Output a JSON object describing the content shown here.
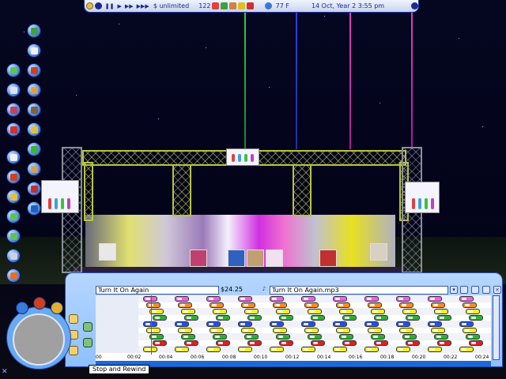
{
  "status_bar": {
    "money": "$ unlimited",
    "speed_value": "122",
    "temperature": "77 F",
    "date_time": "14 Oct, Year 2  3:55 pm",
    "playback_controls": [
      "pause",
      "play",
      "fast",
      "fastest"
    ]
  },
  "panel": {
    "show_name": "Turn It On Again",
    "price": "$24.25",
    "music_track": "Turn It On Again.mp3",
    "timeline_labels": [
      "00",
      "00:02",
      "00:04",
      "00:06",
      "00:08",
      "00:10",
      "00:12",
      "00:14",
      "00:16",
      "00:18",
      "00:20",
      "00:22",
      "00:24"
    ],
    "track_colors": [
      "#f060e0",
      "#ff8a20",
      "#f0f020",
      "#30b030",
      "#2050f0",
      "#f0f020",
      "#30b030",
      "#e02020",
      "#f0f020"
    ],
    "tooltip": "Stop and Rewind"
  },
  "colors": {
    "panel": "#a8ccff",
    "accent": "#1e3aa8"
  },
  "icons": {
    "left_toolbar": [
      "terrain-icon",
      "scenery-icon",
      "paths-icon",
      "rides-icon",
      "guests-icon",
      "shops-icon",
      "staff-icon",
      "finance-icon",
      "stats-icon",
      "research-icon",
      "award-icon",
      "options-icon",
      "park-icon",
      "camera-icon",
      "landscape-icon",
      "tools-icon",
      "info-icon",
      "trash-icon"
    ]
  }
}
